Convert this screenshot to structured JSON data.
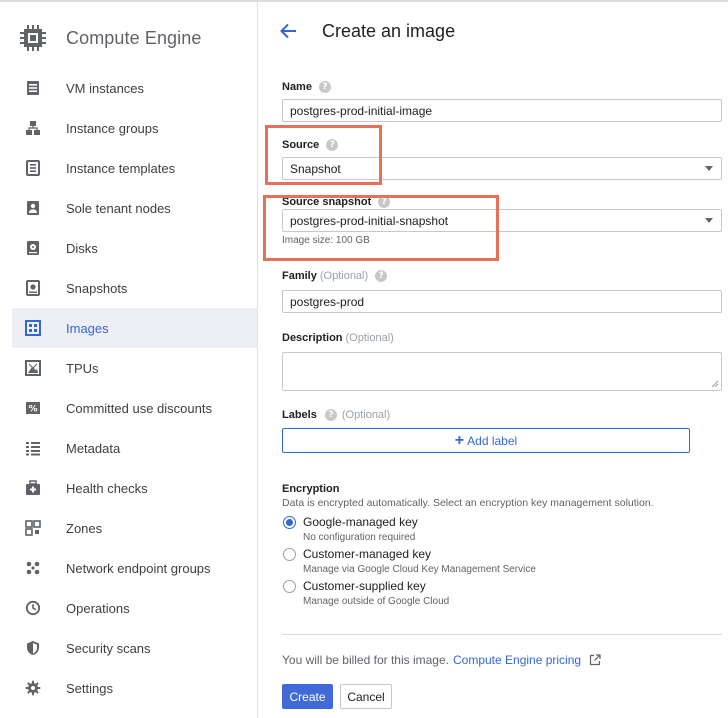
{
  "sidebar": {
    "product_title": "Compute Engine",
    "items": [
      {
        "label": "VM instances",
        "icon": "vm-instances-icon",
        "active": false
      },
      {
        "label": "Instance groups",
        "icon": "instance-groups-icon",
        "active": false
      },
      {
        "label": "Instance templates",
        "icon": "instance-templates-icon",
        "active": false
      },
      {
        "label": "Sole tenant nodes",
        "icon": "sole-tenant-nodes-icon",
        "active": false
      },
      {
        "label": "Disks",
        "icon": "disks-icon",
        "active": false
      },
      {
        "label": "Snapshots",
        "icon": "snapshots-icon",
        "active": false
      },
      {
        "label": "Images",
        "icon": "images-icon",
        "active": true
      },
      {
        "label": "TPUs",
        "icon": "tpus-icon",
        "active": false
      },
      {
        "label": "Committed use discounts",
        "icon": "committed-use-discounts-icon",
        "active": false
      },
      {
        "label": "Metadata",
        "icon": "metadata-icon",
        "active": false
      },
      {
        "label": "Health checks",
        "icon": "health-checks-icon",
        "active": false
      },
      {
        "label": "Zones",
        "icon": "zones-icon",
        "active": false
      },
      {
        "label": "Network endpoint groups",
        "icon": "network-endpoint-groups-icon",
        "active": false
      },
      {
        "label": "Operations",
        "icon": "operations-icon",
        "active": false
      },
      {
        "label": "Security scans",
        "icon": "security-scans-icon",
        "active": false
      },
      {
        "label": "Settings",
        "icon": "settings-icon",
        "active": false
      }
    ]
  },
  "header": {
    "title": "Create an image"
  },
  "form": {
    "name": {
      "label": "Name",
      "value": "postgres-prod-initial-image"
    },
    "source": {
      "label": "Source",
      "value": "Snapshot"
    },
    "source_snapshot": {
      "label": "Source snapshot",
      "value": "postgres-prod-initial-snapshot",
      "hint": "Image size: 100 GB"
    },
    "family": {
      "label": "Family",
      "optional": "(Optional)",
      "value": "postgres-prod"
    },
    "description": {
      "label": "Description",
      "optional": "(Optional)",
      "value": ""
    },
    "labels": {
      "label": "Labels",
      "optional": "(Optional)",
      "add_button": "Add label"
    },
    "encryption": {
      "label": "Encryption",
      "description": "Data is encrypted automatically. Select an encryption key management solution.",
      "options": [
        {
          "title": "Google-managed key",
          "subtitle": "No configuration required",
          "selected": true
        },
        {
          "title": "Customer-managed key",
          "subtitle": "Manage via Google Cloud Key Management Service",
          "selected": false
        },
        {
          "title": "Customer-supplied key",
          "subtitle": "Manage outside of Google Cloud",
          "selected": false
        }
      ]
    },
    "help_glyph": "?"
  },
  "footer": {
    "billing_text": "You will be billed for this image.",
    "pricing_link": "Compute Engine pricing",
    "create_label": "Create",
    "cancel_label": "Cancel"
  },
  "colors": {
    "accent": "#3367d6",
    "highlight": "#e8705b",
    "active_nav_bg": "#eeeff4"
  }
}
